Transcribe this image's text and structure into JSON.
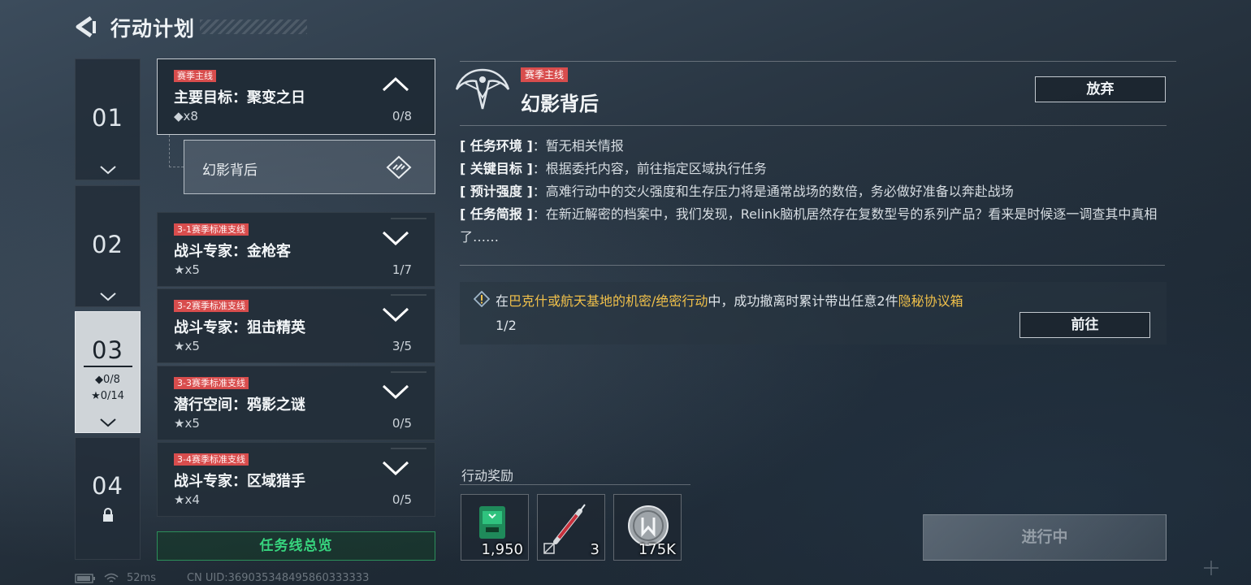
{
  "header": {
    "title": "行动计划"
  },
  "chapters": [
    {
      "num": "01"
    },
    {
      "num": "02"
    },
    {
      "num": "03",
      "diamond_stat": "◆0/8",
      "star_stat": "★0/14"
    },
    {
      "num": "04"
    }
  ],
  "missions": {
    "main": {
      "tag": "赛季主线",
      "title": "主要目标：聚变之日",
      "reward": "◆x8",
      "progress": "0/8"
    },
    "sub": {
      "label": "幻影背后"
    },
    "side": [
      {
        "tag": "3-1赛季标准支线",
        "title": "战斗专家：金枪客",
        "reward": "★x5",
        "progress": "1/7"
      },
      {
        "tag": "3-2赛季标准支线",
        "title": "战斗专家：狙击精英",
        "reward": "★x5",
        "progress": "3/5"
      },
      {
        "tag": "3-3赛季标准支线",
        "title": "潜行空间：鸦影之谜",
        "reward": "★x5",
        "progress": "0/5"
      },
      {
        "tag": "3-4赛季标准支线",
        "title": "战斗专家：区域猎手",
        "reward": "★x4",
        "progress": "0/5"
      }
    ],
    "overview_label": "任务线总览"
  },
  "detail": {
    "tag": "赛季主线",
    "title": "幻影背后",
    "abandon_label": "放弃",
    "info": [
      {
        "key": "[ 任务环境 ]",
        "value": "：暂无相关情报"
      },
      {
        "key": "[ 关键目标 ]",
        "value": "：根据委托内容，前往指定区域执行任务"
      },
      {
        "key": "[ 预计强度 ]",
        "value": "：高难行动中的交火强度和生存压力将是通常战场的数倍，务必做好准备以奔赴战场"
      },
      {
        "key": "[ 任务简报 ]",
        "value": "：在新近解密的档案中，我们发现，Relink脑机居然存在复数型号的系列产品？看来是时候逐一调查其中真相了……"
      }
    ],
    "objective": {
      "pre": "在",
      "loc": "巴克什或航天基地的机密/绝密行动",
      "mid": "中，成功撤离时累计带出任意2件",
      "item": "隐秘协议箱",
      "progress": "1/2",
      "goto_label": "前往"
    },
    "reward_title": "行动奖励",
    "rewards": [
      {
        "icon": "green-crate-icon",
        "qty": "1,950"
      },
      {
        "icon": "syringe-icon",
        "qty": "3"
      },
      {
        "icon": "silver-coin-icon",
        "qty": "175K"
      }
    ],
    "status_button": "进行中"
  },
  "status": {
    "ping": "52ms",
    "uid": "CN UID:369035348495860333333"
  },
  "colors": {
    "tag_red": "#d84d4d",
    "highlight_gold": "#f0c04a",
    "overview_green": "#37d47e"
  }
}
